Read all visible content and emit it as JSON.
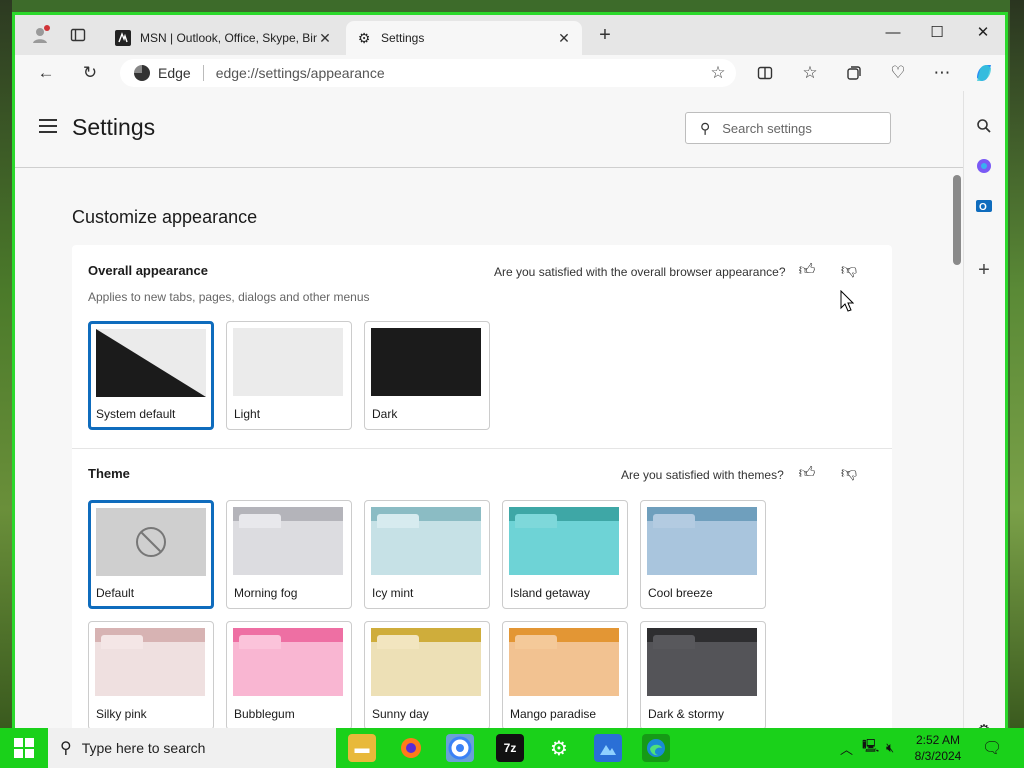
{
  "browser": {
    "tabs": [
      {
        "title": "MSN | Outlook, Office, Skype, Bing",
        "active": false
      },
      {
        "title": "Settings",
        "active": true
      }
    ],
    "address": {
      "brand": "Edge",
      "url": "edge://settings/appearance"
    }
  },
  "settings": {
    "title": "Settings",
    "search_placeholder": "Search settings",
    "section_title": "Customize appearance",
    "overall": {
      "heading": "Overall appearance",
      "feedback": "Are you satisfied with the overall browser appearance?",
      "subtitle": "Applies to new tabs, pages, dialogs and other menus",
      "options": [
        {
          "label": "System default",
          "selected": true
        },
        {
          "label": "Light",
          "selected": false
        },
        {
          "label": "Dark",
          "selected": false
        }
      ]
    },
    "theme": {
      "heading": "Theme",
      "feedback": "Are you satisfied with themes?",
      "options": [
        {
          "label": "Default",
          "selected": true,
          "top": "#cfcfcf",
          "tab": "#cfcfcf",
          "body": "#cfcfcf"
        },
        {
          "label": "Morning fog",
          "selected": false,
          "top": "#b4b4ba",
          "tab": "#e8e8ec",
          "body": "#dcdce0"
        },
        {
          "label": "Icy mint",
          "selected": false,
          "top": "#8bbcc4",
          "tab": "#d7ebef",
          "body": "#c6e1e6"
        },
        {
          "label": "Island getaway",
          "selected": false,
          "top": "#3ea7a6",
          "tab": "#7ed8da",
          "body": "#6ed3d6"
        },
        {
          "label": "Cool breeze",
          "selected": false,
          "top": "#6f9fbd",
          "tab": "#b3cbe1",
          "body": "#a9c5dd"
        },
        {
          "label": "Silky pink",
          "selected": false,
          "top": "#d7b3b3",
          "tab": "#f4e6e6",
          "body": "#efe0e0"
        },
        {
          "label": "Bubblegum",
          "selected": false,
          "top": "#ee6fa3",
          "tab": "#fbc3da",
          "body": "#f9b6d2"
        },
        {
          "label": "Sunny day",
          "selected": false,
          "top": "#cfad3b",
          "tab": "#f2e5bf",
          "body": "#ede0b6"
        },
        {
          "label": "Mango paradise",
          "selected": false,
          "top": "#e39634",
          "tab": "#f4c999",
          "body": "#f2c291"
        },
        {
          "label": "Dark & stormy",
          "selected": false,
          "top": "#2e2e30",
          "tab": "#58585c",
          "body": "#545458"
        }
      ]
    }
  },
  "taskbar": {
    "search_placeholder": "Type here to search",
    "time": "2:52 AM",
    "date": "8/3/2024"
  },
  "colors": {
    "accent": "#0f6cbd",
    "window_border": "#2bd92b",
    "taskbar": "#1ad11a"
  }
}
